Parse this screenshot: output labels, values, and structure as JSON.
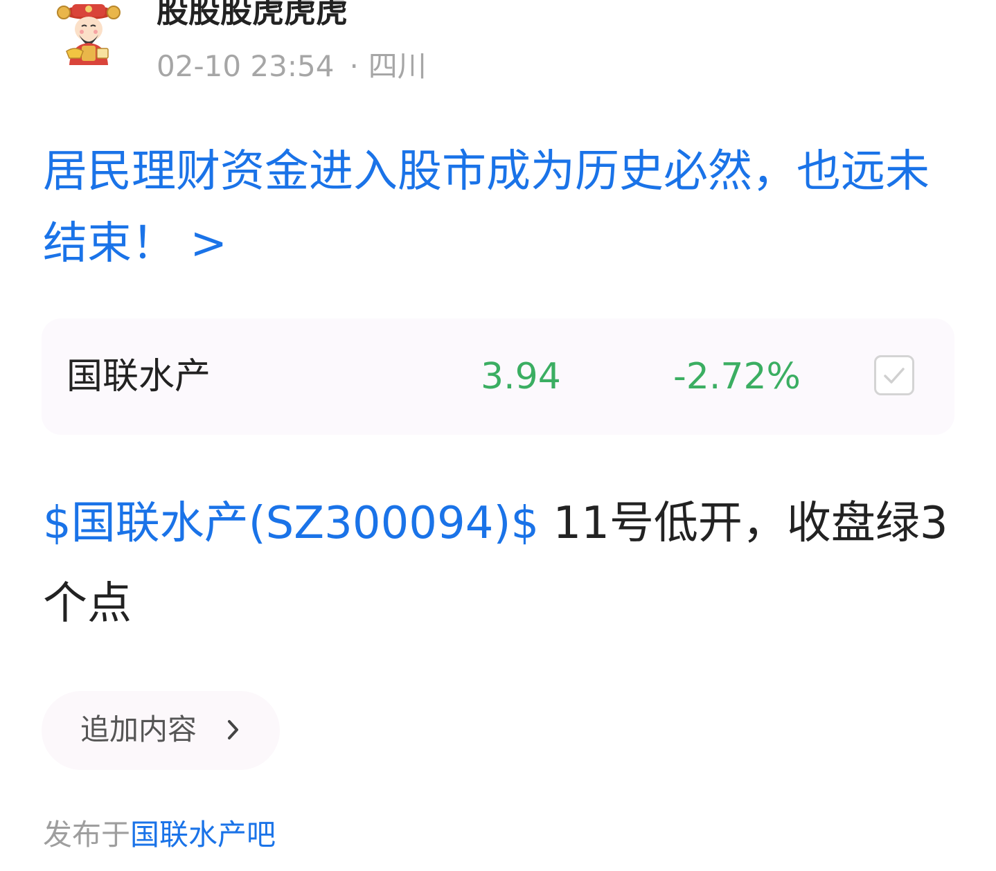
{
  "author": {
    "name": "股股股虎虎虎",
    "date": "02-10 23:54",
    "separator": "·",
    "location": "四川"
  },
  "post": {
    "title": "居民理财资金进入股市成为历史必然，也远未结束！ >",
    "stock_link": "$国联水产(SZ300094)$",
    "body_text": "11号低开，收盘绿3个点"
  },
  "stock_card": {
    "name": "国联水产",
    "price": "3.94",
    "change": "-2.72%",
    "change_color": "#3bae62",
    "check_icon": "checkbox-checked-icon"
  },
  "actions": {
    "append_label": "追加内容",
    "append_icon": "chevron-right-icon"
  },
  "footer": {
    "publish_prefix": "发布于",
    "forum_name": "国联水产吧"
  },
  "colors": {
    "link": "#1a73e8",
    "muted": "#a6a6a6",
    "card_bg": "#fcf9fd"
  }
}
